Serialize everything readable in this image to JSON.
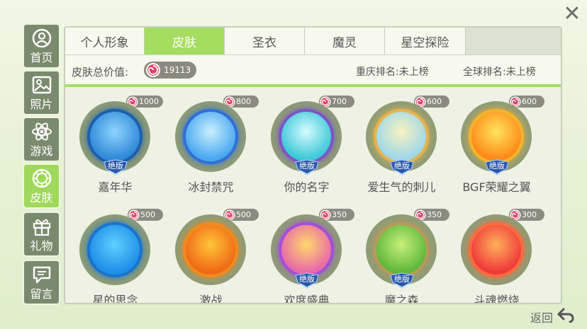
{
  "sidebar": {
    "items": [
      {
        "label": "首页",
        "icon": "profile-icon"
      },
      {
        "label": "照片",
        "icon": "photo-icon"
      },
      {
        "label": "游戏",
        "icon": "atom-icon"
      },
      {
        "label": "皮肤",
        "icon": "skin-icon"
      },
      {
        "label": "礼物",
        "icon": "gift-icon"
      },
      {
        "label": "留言",
        "icon": "message-icon"
      }
    ],
    "active_index": 3
  },
  "tabs": [
    {
      "label": "个人形象"
    },
    {
      "label": "皮肤"
    },
    {
      "label": "圣衣"
    },
    {
      "label": "魔灵"
    },
    {
      "label": "星空探险"
    }
  ],
  "active_tab": 1,
  "info": {
    "total_label": "皮肤总价值:",
    "total_value": "19113",
    "local_rank": "重庆排名:未上榜",
    "global_rank": "全球排名:未上榜"
  },
  "skins": [
    {
      "name": "嘉年华",
      "price": "1000",
      "badge": true,
      "colors": [
        "#2f8ad8",
        "#8fd4ff"
      ],
      "glow": "#1b5fb0"
    },
    {
      "name": "冰封禁咒",
      "price": "800",
      "badge": false,
      "colors": [
        "#4aa8f0",
        "#c8f0ff"
      ],
      "glow": "#2f6fd8"
    },
    {
      "name": "你的名字",
      "price": "700",
      "badge": true,
      "colors": [
        "#3dc9d8",
        "#d6fbff"
      ],
      "glow": "#7b55c8"
    },
    {
      "name": "爱生气的刺儿",
      "price": "600",
      "badge": true,
      "colors": [
        "#9fd8e8",
        "#f8f2c0"
      ],
      "glow": "#e8b24a"
    },
    {
      "name": "BGF荣耀之翼",
      "price": "600",
      "badge": true,
      "colors": [
        "#ff8a1a",
        "#ffe45c"
      ],
      "glow": "#f5b42a"
    },
    {
      "name": "星的思念",
      "price": "500",
      "badge": false,
      "colors": [
        "#1f8fe8",
        "#5fd0ff"
      ],
      "glow": "#1674d0"
    },
    {
      "name": "激战",
      "price": "500",
      "badge": false,
      "colors": [
        "#f06a14",
        "#ffc53a"
      ],
      "glow": "#f28a1c"
    },
    {
      "name": "欢度盛典",
      "price": "350",
      "badge": true,
      "colors": [
        "#e86aa8",
        "#ffd86a"
      ],
      "glow": "#a24fd8"
    },
    {
      "name": "魔之森",
      "price": "350",
      "badge": true,
      "colors": [
        "#5fb83a",
        "#c8f07a"
      ],
      "glow": "#b89a5a"
    },
    {
      "name": "斗魂燃烧",
      "price": "300",
      "badge": false,
      "colors": [
        "#f03a3a",
        "#ffb05a"
      ],
      "glow": "#ff6a3a"
    }
  ],
  "badge_text": "绝版",
  "footer": {
    "back_label": "返回"
  },
  "colors": {
    "accent": "#a4dd60",
    "sidebar": "#7a8a6d",
    "pill": "#8a8a7e",
    "coin": "#e8456a"
  }
}
